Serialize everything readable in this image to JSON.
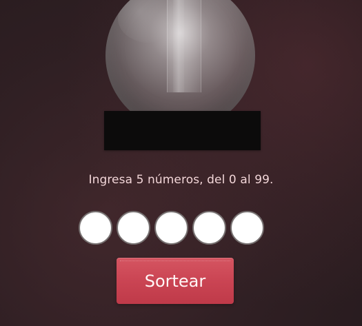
{
  "machine": {
    "globe_visible": true,
    "base_visible": true
  },
  "instruction_text": "Ingresa 5 números, del 0 al 99.",
  "number_inputs": [
    {
      "value": "",
      "placeholder": ""
    },
    {
      "value": "",
      "placeholder": ""
    },
    {
      "value": "",
      "placeholder": ""
    },
    {
      "value": "",
      "placeholder": ""
    },
    {
      "value": "",
      "placeholder": ""
    }
  ],
  "actions": {
    "draw_button_label": "Sortear"
  },
  "colors": {
    "instruction_text": "#f2d6d8",
    "input_border": "#756f6f",
    "button_bg": "#c94352",
    "button_text": "#fff6f6",
    "background_dark": "#2b1f22",
    "base": "#0c0b0b"
  }
}
